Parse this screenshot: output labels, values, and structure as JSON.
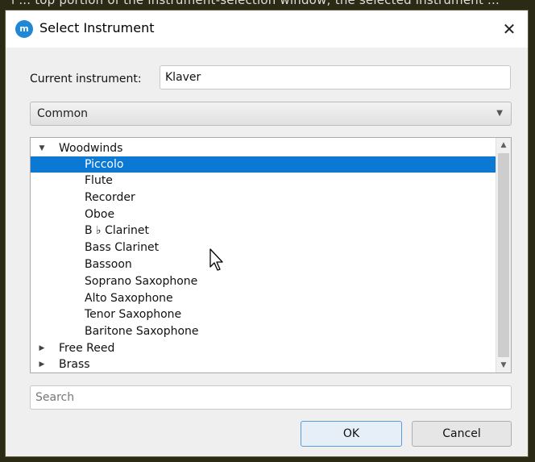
{
  "background_text": "i ... top portion of the instrument-selection window; the selected instrument ...",
  "dialog": {
    "title": "Select Instrument",
    "app_icon": "musescore-logo-icon",
    "close_icon": "close-icon",
    "close_glyph": "✕"
  },
  "current_instrument": {
    "label": "Current instrument:",
    "value": "Klaver"
  },
  "category_combo": {
    "selected": "Common"
  },
  "tree": {
    "rows": [
      {
        "label": "Woodwinds",
        "level": 0,
        "expanded": true
      },
      {
        "label": "Piccolo",
        "level": 1,
        "selected": true
      },
      {
        "label": "Flute",
        "level": 1
      },
      {
        "label": "Recorder",
        "level": 1
      },
      {
        "label": "Oboe",
        "level": 1
      },
      {
        "label": "B ♭ Clarinet",
        "level": 1
      },
      {
        "label": "Bass Clarinet",
        "level": 1
      },
      {
        "label": "Bassoon",
        "level": 1
      },
      {
        "label": "Soprano Saxophone",
        "level": 1
      },
      {
        "label": "Alto Saxophone",
        "level": 1
      },
      {
        "label": "Tenor Saxophone",
        "level": 1
      },
      {
        "label": "Baritone Saxophone",
        "level": 1
      },
      {
        "label": "Free Reed",
        "level": 0,
        "expanded": false
      },
      {
        "label": "Brass",
        "level": 0,
        "expanded": false
      }
    ]
  },
  "search": {
    "placeholder": "Search",
    "value": ""
  },
  "buttons": {
    "ok": "OK",
    "cancel": "Cancel"
  },
  "colors": {
    "selection": "#0b78d3",
    "logo": "#1e88d6",
    "outer_background": "#2b2a14"
  }
}
